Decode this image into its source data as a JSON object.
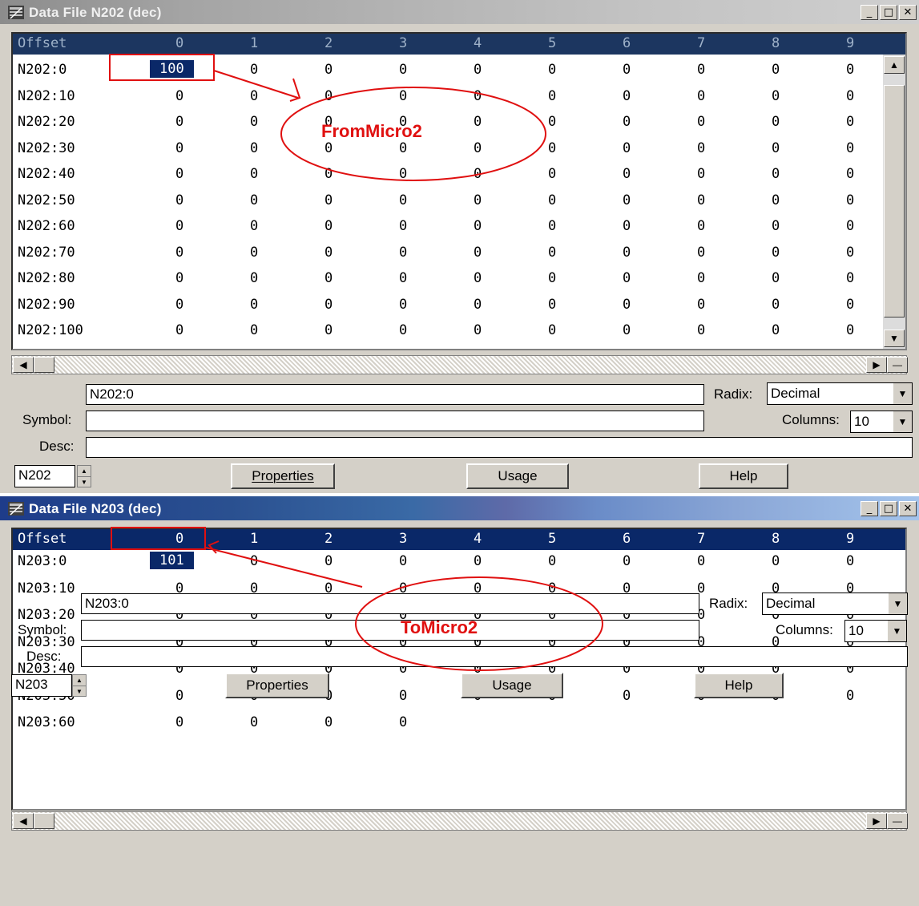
{
  "colors": {
    "annotation": "#e01010",
    "selection": "#0a2868"
  },
  "window1": {
    "title": "Data File N202 (dec)",
    "columns": [
      "Offset",
      "0",
      "1",
      "2",
      "3",
      "4",
      "5",
      "6",
      "7",
      "8",
      "9"
    ],
    "rows": [
      [
        "N202:0",
        "100",
        "0",
        "0",
        "0",
        "0",
        "0",
        "0",
        "0",
        "0",
        "0"
      ],
      [
        "N202:10",
        "0",
        "0",
        "0",
        "0",
        "0",
        "0",
        "0",
        "0",
        "0",
        "0"
      ],
      [
        "N202:20",
        "0",
        "0",
        "0",
        "0",
        "0",
        "0",
        "0",
        "0",
        "0",
        "0"
      ],
      [
        "N202:30",
        "0",
        "0",
        "0",
        "0",
        "0",
        "0",
        "0",
        "0",
        "0",
        "0"
      ],
      [
        "N202:40",
        "0",
        "0",
        "0",
        "0",
        "0",
        "0",
        "0",
        "0",
        "0",
        "0"
      ],
      [
        "N202:50",
        "0",
        "0",
        "0",
        "0",
        "0",
        "0",
        "0",
        "0",
        "0",
        "0"
      ],
      [
        "N202:60",
        "0",
        "0",
        "0",
        "0",
        "0",
        "0",
        "0",
        "0",
        "0",
        "0"
      ],
      [
        "N202:70",
        "0",
        "0",
        "0",
        "0",
        "0",
        "0",
        "0",
        "0",
        "0",
        "0"
      ],
      [
        "N202:80",
        "0",
        "0",
        "0",
        "0",
        "0",
        "0",
        "0",
        "0",
        "0",
        "0"
      ],
      [
        "N202:90",
        "0",
        "0",
        "0",
        "0",
        "0",
        "0",
        "0",
        "0",
        "0",
        "0"
      ],
      [
        "N202:100",
        "0",
        "0",
        "0",
        "0",
        "0",
        "0",
        "0",
        "0",
        "0",
        "0"
      ]
    ],
    "address": "N202:0",
    "symbol_label": "Symbol:",
    "desc_label": "Desc:",
    "radix_label": "Radix:",
    "radix_value": "Decimal",
    "columns_label": "Columns:",
    "columns_value": "10",
    "file_value": "N202",
    "properties": "Properties",
    "usage": "Usage",
    "help": "Help",
    "annotation": "FromMicro2"
  },
  "window2": {
    "title": "Data File N203 (dec)",
    "columns": [
      "Offset",
      "0",
      "1",
      "2",
      "3",
      "4",
      "5",
      "6",
      "7",
      "8",
      "9"
    ],
    "rows": [
      [
        "N203:0",
        "101",
        "0",
        "0",
        "0",
        "0",
        "0",
        "0",
        "0",
        "0",
        "0"
      ],
      [
        "N203:10",
        "0",
        "0",
        "0",
        "0",
        "0",
        "0",
        "0",
        "0",
        "0",
        "0"
      ],
      [
        "N203:20",
        "0",
        "0",
        "0",
        "0",
        "0",
        "0",
        "0",
        "0",
        "0",
        "0"
      ],
      [
        "N203:30",
        "0",
        "0",
        "0",
        "0",
        "0",
        "0",
        "0",
        "0",
        "0",
        "0"
      ],
      [
        "N203:40",
        "0",
        "0",
        "0",
        "0",
        "0",
        "0",
        "0",
        "0",
        "0",
        "0"
      ],
      [
        "N203:50",
        "0",
        "0",
        "0",
        "0",
        "0",
        "0",
        "0",
        "0",
        "0",
        "0"
      ],
      [
        "N203:60",
        "0",
        "0",
        "0",
        "0"
      ]
    ],
    "address": "N203:0",
    "symbol_label": "Symbol:",
    "desc_label": "Desc:",
    "radix_label": "Radix:",
    "radix_value": "Decimal",
    "columns_label": "Columns:",
    "columns_value": "10",
    "file_value": "N203",
    "properties": "Properties",
    "usage": "Usage",
    "help": "Help",
    "annotation": "ToMicro2"
  }
}
